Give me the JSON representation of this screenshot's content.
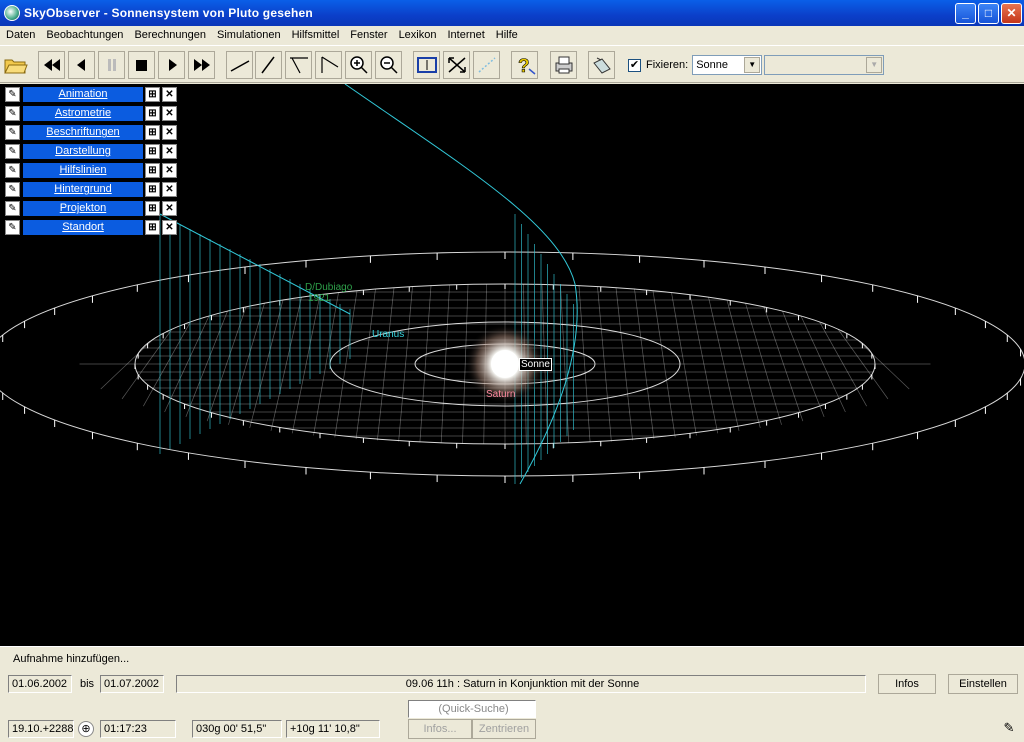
{
  "window": {
    "title": "SkyObserver - Sonnensystem von Pluto gesehen",
    "minimize": "_",
    "maximize": "□",
    "close": "✕"
  },
  "menu": [
    "Daten",
    "Beobachtungen",
    "Berechnungen",
    "Simulationen",
    "Hilfsmittel",
    "Fenster",
    "Lexikon",
    "Internet",
    "Hilfe"
  ],
  "toolbar": {
    "fix_label": "Fixieren:",
    "fix_checked": "✔",
    "fix_target": "Sonne",
    "second_combo": ""
  },
  "panels": [
    "Animation",
    "Astrometrie",
    "Beschriftungen",
    "Darstellung",
    "Hilfslinien",
    "Hintergrund",
    "Projekton",
    "Standort"
  ],
  "scene": {
    "labels": {
      "dubiago": "D/Dubiago",
      "dubiago_year": "1921",
      "uranus": "Uranus",
      "sun": "Sonne",
      "saturn": "Saturn"
    },
    "colors": {
      "grid": "#ffffff",
      "curtain": "#32c8d8",
      "dubiago": "#2ea04a",
      "uranus": "#36d6e0",
      "saturn": "#ff8aa0"
    }
  },
  "status": {
    "message": "Aufnahme hinzufügen..."
  },
  "bottom": {
    "date_from": "01.06.2002",
    "bis": "bis",
    "date_to": "01.07.2002",
    "event": "09.06  11h :  Saturn in Konjunktion mit der Sonne",
    "infos_button": "Infos",
    "settings_button": "Einstellen",
    "date_code": "19.10.+2288",
    "time": "01:17:23",
    "ra": "030g 00' 51,5\"",
    "dec": "+10g 11' 10,8\"",
    "quick_search": "(Quick-Suche)",
    "infos2": "Infos...",
    "center": "Zentrieren"
  }
}
